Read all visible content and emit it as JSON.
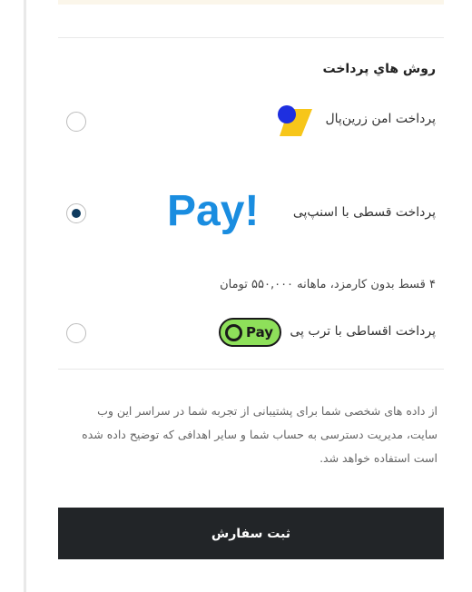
{
  "payment": {
    "section_title": "روش هاي پرداخت",
    "options": [
      {
        "label": "پرداخت امن زرین‌پال",
        "selected": false,
        "icon": "zarinpal-logo"
      },
      {
        "label": "پرداخت قسطی با اسنپ‌پی",
        "selected": true,
        "icon": "snapp-pay-logo",
        "logo_text": "Pay!"
      },
      {
        "label": "پرداخت اقساطی با ترب پی",
        "selected": false,
        "icon": "torob-pay-logo",
        "logo_text": "Pay"
      }
    ],
    "installment_note": "۴ قسط بدون کارمزد، ماهانه ۵۵۰,۰۰۰ تومان"
  },
  "privacy_text": "از داده های شخصی شما برای پشتیبانی از تجربه شما در سراسر این وب سایت، مدیریت دسترسی به حساب شما و سایر اهدافی که توضیح داده شده است استفاده خواهد شد.",
  "submit_label": "ثبت سفارش",
  "colors": {
    "radio_selected": "#0f3b5f",
    "snapp_blue": "#1a8de0",
    "torob_green": "#8ee05a",
    "button_bg": "#222528"
  }
}
